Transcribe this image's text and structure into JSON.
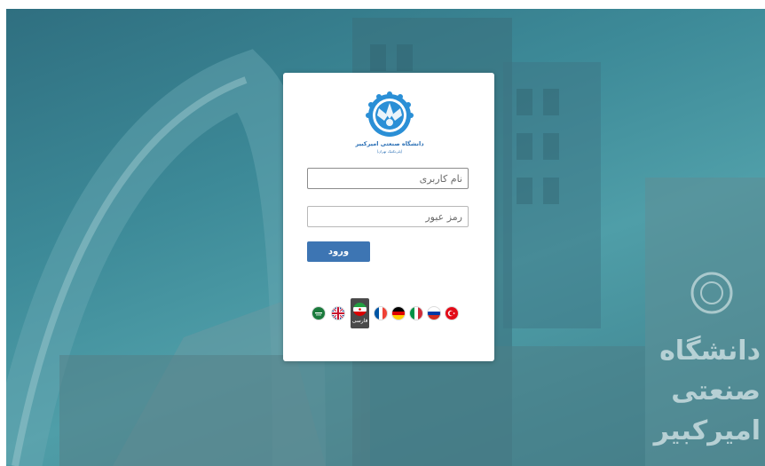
{
  "login": {
    "username_placeholder": "نام کاربری",
    "password_placeholder": "رمز عبور",
    "submit_label": "ورود"
  },
  "logo": {
    "university_name": "دانشگاه صنعتی امیرکبیر",
    "subtitle": "(پلی‌تکنیک تهران)"
  },
  "languages": [
    {
      "name": "arabic",
      "flag": "saudi-arabia-flag-icon"
    },
    {
      "name": "english",
      "flag": "uk-flag-icon"
    },
    {
      "name": "persian",
      "flag": "iran-flag-icon",
      "label": "فارسی",
      "active": true
    },
    {
      "name": "french",
      "flag": "france-flag-icon"
    },
    {
      "name": "german",
      "flag": "germany-flag-icon"
    },
    {
      "name": "italian",
      "flag": "italy-flag-icon"
    },
    {
      "name": "russian",
      "flag": "russia-flag-icon"
    },
    {
      "name": "turkish",
      "flag": "turkey-flag-icon"
    }
  ],
  "active_language_label": "فارسی",
  "background": {
    "sign_text": "دانشگاه صنعتی امیرکبیر"
  },
  "colors": {
    "primary_button": "#3d75b3",
    "background_tint": "#3d8a98",
    "logo_blue": "#2a8fd6"
  }
}
